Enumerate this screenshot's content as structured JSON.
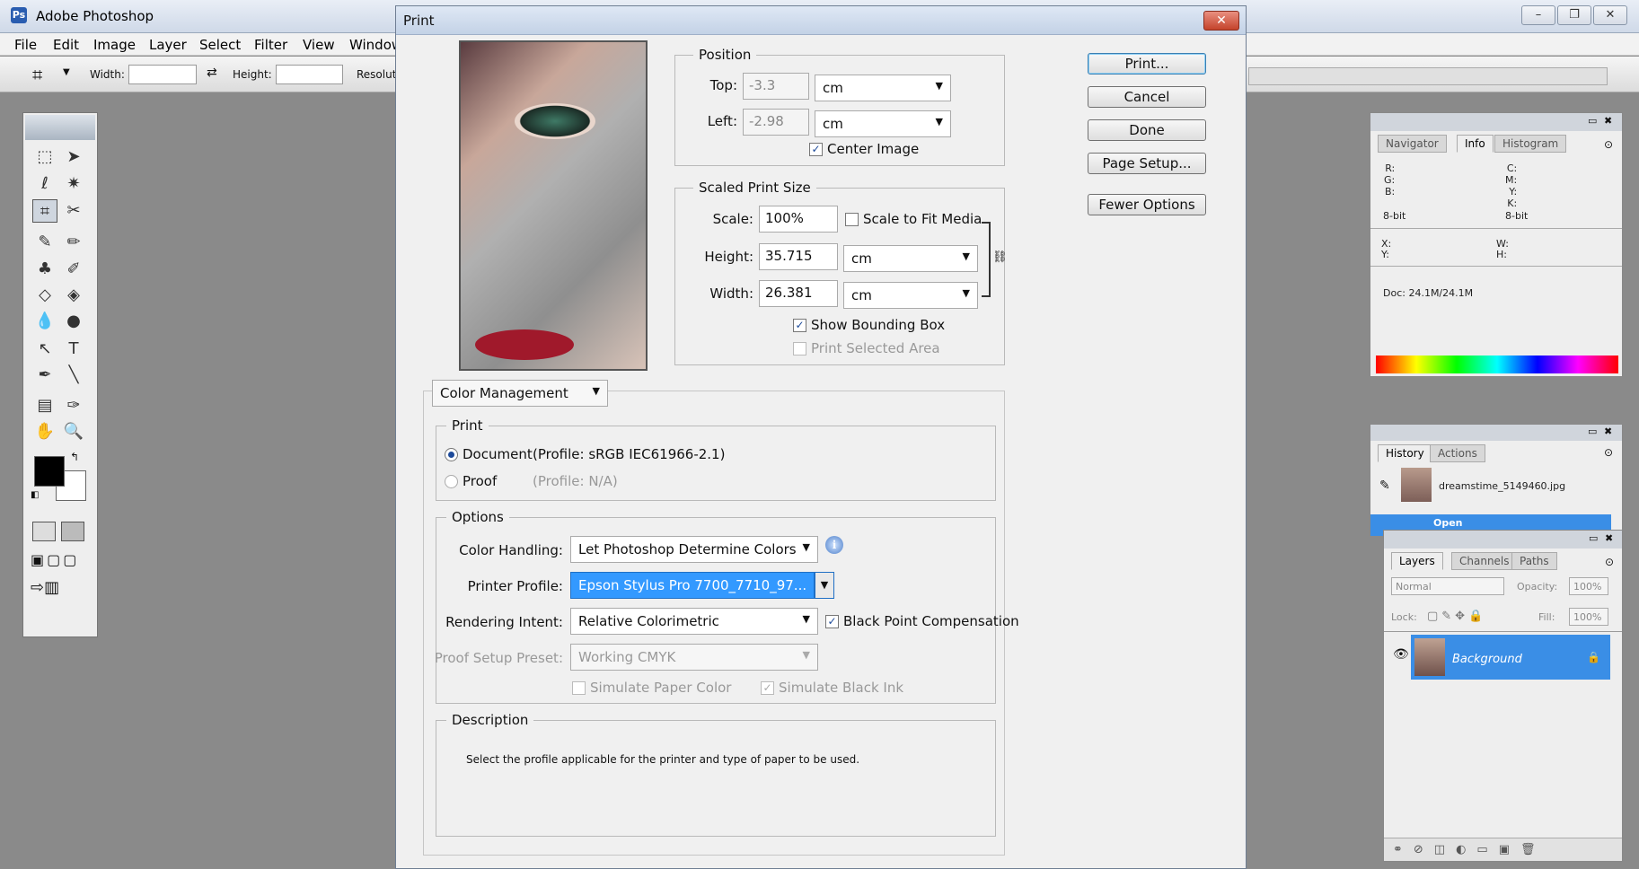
{
  "app": {
    "title": "Adobe Photoshop"
  },
  "menu": [
    "File",
    "Edit",
    "Image",
    "Layer",
    "Select",
    "Filter",
    "View",
    "Window"
  ],
  "options_bar": {
    "width_label": "Width:",
    "height_label": "Height:",
    "resolution_label": "Resolut"
  },
  "info_panel": {
    "tabs": [
      "Navigator",
      "Info",
      "Histogram"
    ],
    "rgb": "R:\nG:\nB:",
    "cmyk": "C:\nM:\nY:\nK:",
    "bit_left": "8-bit",
    "bit_right": "8-bit",
    "xy": "X:\nY:",
    "wh": "W:\nH:",
    "doc": "Doc: 24.1M/24.1M"
  },
  "history_panel": {
    "tabs": [
      "History",
      "Actions"
    ],
    "snapshot": "dreamstime_5149460.jpg",
    "state": "Open"
  },
  "layers_panel": {
    "tabs": [
      "Layers",
      "Channels",
      "Paths"
    ],
    "blend_mode": "Normal",
    "opacity_label": "Opacity:",
    "opacity": "100%",
    "lock_label": "Lock:",
    "fill_label": "Fill:",
    "fill": "100%",
    "layer_name": "Background"
  },
  "dialog": {
    "title": "Print",
    "close": "✕",
    "buttons": {
      "print": "Print...",
      "cancel": "Cancel",
      "done": "Done",
      "page_setup": "Page Setup...",
      "fewer_options": "Fewer Options"
    },
    "position": {
      "legend": "Position",
      "top_label": "Top:",
      "top_value": "-3.3",
      "top_unit": "cm",
      "left_label": "Left:",
      "left_value": "-2.98",
      "left_unit": "cm",
      "center_image": "Center Image"
    },
    "scaled": {
      "legend": "Scaled Print Size",
      "scale_label": "Scale:",
      "scale_value": "100%",
      "fit_media": "Scale to Fit Media",
      "height_label": "Height:",
      "height_value": "35.715",
      "height_unit": "cm",
      "width_label": "Width:",
      "width_value": "26.381",
      "width_unit": "cm",
      "bounding_box": "Show Bounding Box",
      "selected_area": "Print Selected Area"
    },
    "color_mgmt_select": "Color Management",
    "print_group": {
      "legend": "Print",
      "document": "Document",
      "document_profile": "(Profile: sRGB IEC61966-2.1)",
      "proof": "Proof",
      "proof_profile": "(Profile: N/A)"
    },
    "options_group": {
      "legend": "Options",
      "color_handling_label": "Color Handling:",
      "color_handling": "Let Photoshop Determine Colors",
      "printer_profile_label": "Printer Profile:",
      "printer_profile": "Epson Stylus Pro 7700_7710_97...",
      "rendering_intent_label": "Rendering Intent:",
      "rendering_intent": "Relative Colorimetric",
      "black_point": "Black Point Compensation",
      "proof_setup_label": "Proof Setup Preset:",
      "proof_setup": "Working CMYK",
      "simulate_paper": "Simulate Paper Color",
      "simulate_ink": "Simulate Black Ink"
    },
    "description": {
      "legend": "Description",
      "text": "Select the profile applicable for the printer and type of paper to be used."
    }
  },
  "colors": {
    "selection": "#3399ff",
    "layer_highlight": "#3a8ee6"
  }
}
